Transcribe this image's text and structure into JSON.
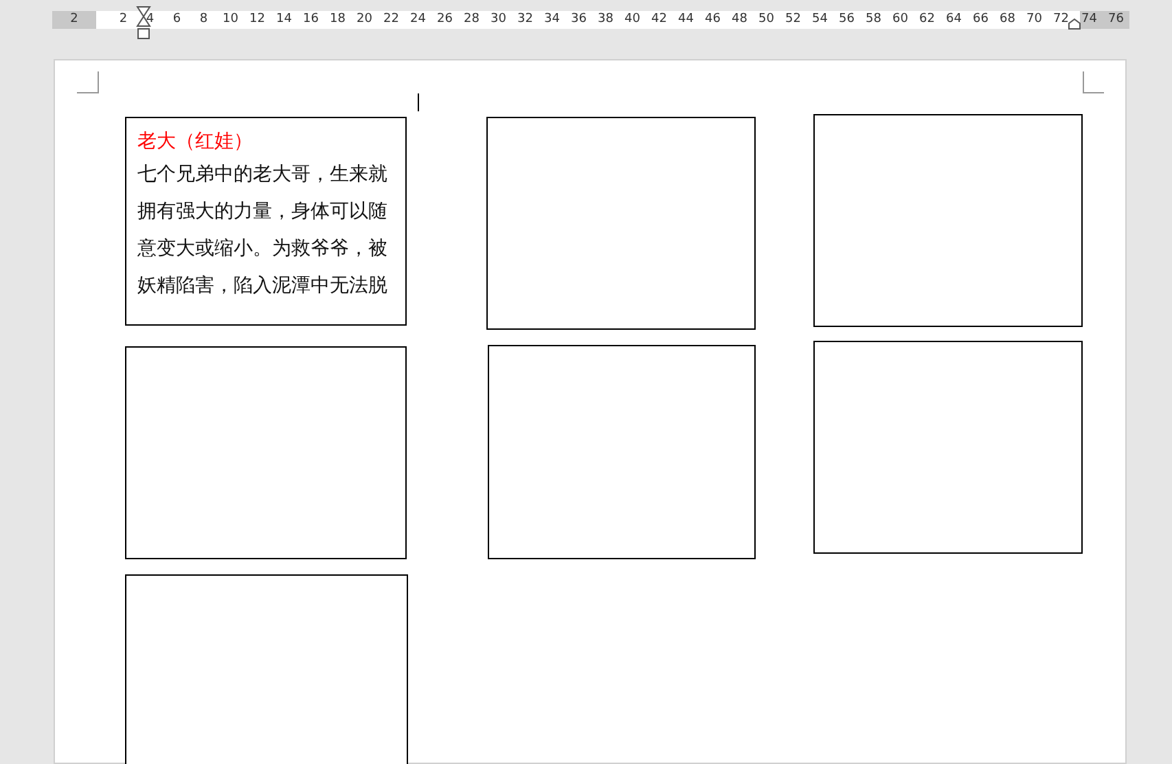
{
  "ruler": {
    "left_margin_numbers": [
      "2"
    ],
    "numbers": [
      "2",
      "4",
      "6",
      "8",
      "10",
      "12",
      "14",
      "16",
      "18",
      "20",
      "22",
      "24",
      "26",
      "28",
      "30",
      "32",
      "34",
      "36",
      "38",
      "40",
      "42",
      "44",
      "46",
      "48",
      "50",
      "52",
      "54",
      "56",
      "58",
      "60",
      "62",
      "64",
      "66",
      "68",
      "70",
      "72"
    ],
    "right_margin_numbers": [
      "74",
      "76"
    ]
  },
  "text_boxes": [
    {
      "kind": "text",
      "title": "老大（红娃）",
      "body": "七个兄弟中的老大哥，生来就拥有强大的力量，身体可以随意变大或缩小。为救爷爷，被妖精陷害，陷入泥潭中无法脱"
    },
    {
      "kind": "empty"
    },
    {
      "kind": "empty"
    },
    {
      "kind": "empty"
    },
    {
      "kind": "empty"
    },
    {
      "kind": "empty"
    },
    {
      "kind": "empty"
    }
  ]
}
